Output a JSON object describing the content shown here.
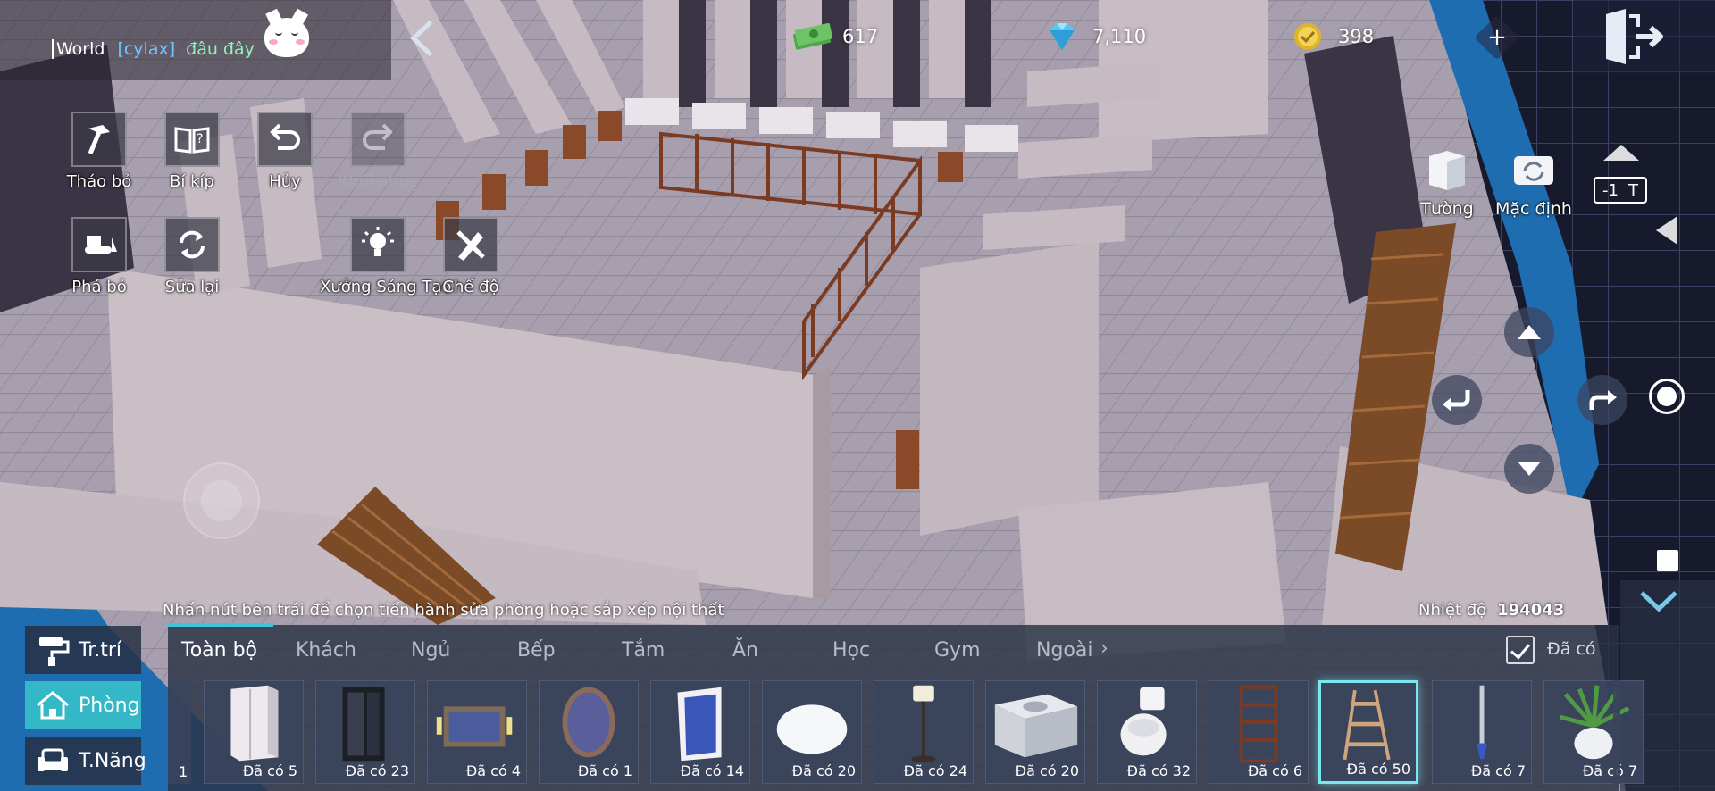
{
  "chat": {
    "channel": "World",
    "player": "[cylax]",
    "message": "đâu đây"
  },
  "currencies": {
    "cash": "617",
    "gems": "7,110",
    "coins": "398"
  },
  "tools": {
    "remove": "Tháo bỏ",
    "guide": "Bí kíp",
    "undo": "Hủy",
    "redo": "Khôi phục",
    "demolish": "Phá bỏ",
    "repair": "Sửa lại",
    "workshop": "Xưởng Sáng Tạo",
    "mode": "Chế độ"
  },
  "view_controls": {
    "wall": "Tường",
    "default": "Mặc định",
    "floor_value": "-1",
    "floor_suffix": "T"
  },
  "hint": "Nhấn nút bên trái để chọn tiến hành sửa phòng hoặc sắp xếp nội thất",
  "temperature": {
    "label": "Nhiệt độ",
    "value": "194043"
  },
  "side_tabs": [
    {
      "label": "Tr.trí",
      "active": false
    },
    {
      "label": "Phòng",
      "active": true
    },
    {
      "label": "T.Năng",
      "active": false
    }
  ],
  "categories": [
    "Toàn bộ",
    "Khách",
    "Ngủ",
    "Bếp",
    "Tắm",
    "Ăn",
    "Học",
    "Gym",
    "Ngoài"
  ],
  "owned_filter": "Đã có",
  "partial_item_count": "1",
  "items": [
    {
      "icon": "wardrobe-white",
      "count": "Đã có 5"
    },
    {
      "icon": "glass-cabinet",
      "count": "Đã có 23"
    },
    {
      "icon": "vanity-mirror",
      "count": "Đã có 4"
    },
    {
      "icon": "oval-mirror",
      "count": "Đã có 1"
    },
    {
      "icon": "lighted-mirror",
      "count": "Đã có 14"
    },
    {
      "icon": "round-rug",
      "count": "Đã có 20"
    },
    {
      "icon": "floor-lamp",
      "count": "Đã có 24"
    },
    {
      "icon": "sink-cabinet",
      "count": "Đã có 20"
    },
    {
      "icon": "toilet",
      "count": "Đã có 32"
    },
    {
      "icon": "wooden-shelf",
      "count": "Đã có 6"
    },
    {
      "icon": "ladder-shelf",
      "count": "Đã có 50",
      "selected": true
    },
    {
      "icon": "standing-torch",
      "count": "Đã có 7"
    },
    {
      "icon": "potted-plant",
      "count": "Đã có 7"
    }
  ],
  "colors": {
    "accent": "#3ec4d6",
    "panel": "#2a3246",
    "wall": "#c9bfc6",
    "floor": "#a39ca8",
    "water": "#1e6fa8"
  }
}
